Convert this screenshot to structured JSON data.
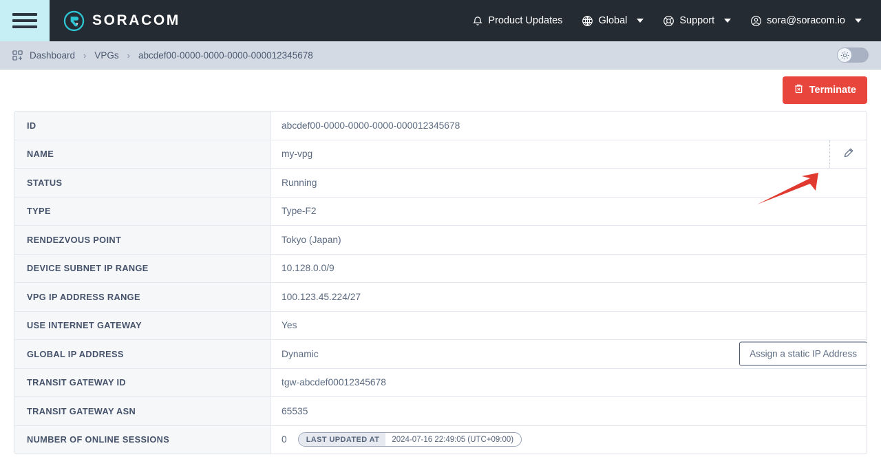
{
  "header": {
    "menu_icon": "hamburger-icon",
    "brand": "SORACOM",
    "nav": [
      {
        "label": "Product Updates",
        "icon": "bell-icon",
        "caret": false
      },
      {
        "label": "Global",
        "icon": "globe-icon",
        "caret": true
      },
      {
        "label": "Support",
        "icon": "lifebuoy-icon",
        "caret": true
      },
      {
        "label": "sora@soracom.io",
        "icon": "user-circle-icon",
        "caret": true
      }
    ]
  },
  "breadcrumb": {
    "icon": "dashboard-grid-plus-icon",
    "items": [
      "Dashboard",
      "VPGs",
      "abcdef00-0000-0000-0000-000012345678"
    ],
    "separator": "›",
    "theme_toggle": {
      "name": "light-dark-toggle",
      "state": "light",
      "icon": "sun-icon"
    }
  },
  "toolbar": {
    "terminate_label": "Terminate",
    "terminate_icon": "trash-x-icon",
    "terminate_color": "#e8453c"
  },
  "annotation": {
    "type": "arrow",
    "color": "#e0392f",
    "points_to": "Terminate"
  },
  "details": {
    "rows": [
      {
        "label": "ID",
        "value": "abcdef00-0000-0000-0000-000012345678"
      },
      {
        "label": "NAME",
        "value": "my-vpg",
        "edit_icon": "pencil-icon"
      },
      {
        "label": "STATUS",
        "value": "Running"
      },
      {
        "label": "TYPE",
        "value": "Type-F2"
      },
      {
        "label": "RENDEZVOUS POINT",
        "value": "Tokyo (Japan)"
      },
      {
        "label": "DEVICE SUBNET IP RANGE",
        "value": "10.128.0.0/9"
      },
      {
        "label": "VPG IP ADDRESS RANGE",
        "value": "100.123.45.224/27"
      },
      {
        "label": "USE INTERNET GATEWAY",
        "value": "Yes"
      },
      {
        "label": "GLOBAL IP ADDRESS",
        "value": "Dynamic",
        "action_label": "Assign a static IP Address"
      },
      {
        "label": "TRANSIT GATEWAY ID",
        "value": "tgw-abcdef00012345678"
      },
      {
        "label": "TRANSIT GATEWAY ASN",
        "value": "65535"
      },
      {
        "label": "NUMBER OF ONLINE SESSIONS",
        "value": "0",
        "badge": {
          "left": "LAST UPDATED AT",
          "right": "2024-07-16 22:49:05 (UTC+09:00)"
        }
      }
    ]
  }
}
